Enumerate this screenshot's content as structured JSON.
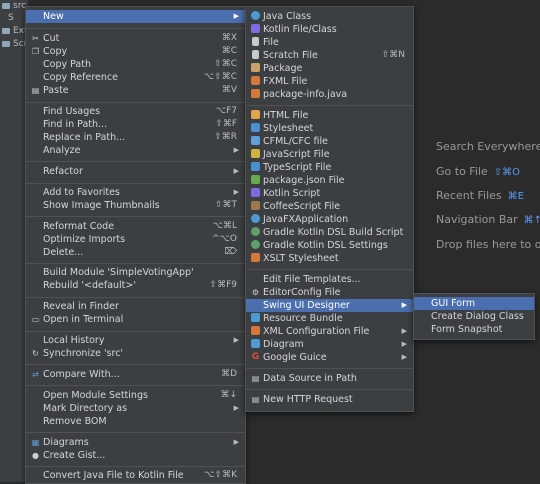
{
  "tree": [
    {
      "label": "src"
    },
    {
      "label": "S"
    },
    {
      "label": "Exte"
    },
    {
      "label": "Scra"
    }
  ],
  "hints": [
    {
      "label": "Search Everywhere",
      "shortcut": ""
    },
    {
      "label": "Go to File",
      "shortcut": "⇧⌘O"
    },
    {
      "label": "Recent Files",
      "shortcut": "⌘E"
    },
    {
      "label": "Navigation Bar",
      "shortcut": "⌘↑"
    },
    {
      "label": "Drop files here to op",
      "shortcut": ""
    }
  ],
  "context_menu": [
    {
      "label": "New",
      "shortcut": "",
      "submenu": true,
      "icon": ""
    },
    {
      "label": "Cut",
      "shortcut": "⌘X",
      "icon": "cut-icon"
    },
    {
      "label": "Copy",
      "shortcut": "⌘C",
      "icon": "copy-icon"
    },
    {
      "label": "Copy Path",
      "shortcut": "⇧⌘C",
      "icon": ""
    },
    {
      "label": "Copy Reference",
      "shortcut": "⌥⇧⌘C",
      "icon": ""
    },
    {
      "label": "Paste",
      "shortcut": "⌘V",
      "icon": "paste-icon"
    },
    {
      "label": "Find Usages",
      "shortcut": "⌥F7",
      "icon": ""
    },
    {
      "label": "Find in Path...",
      "shortcut": "⇧⌘F",
      "icon": ""
    },
    {
      "label": "Replace in Path...",
      "shortcut": "⇧⌘R",
      "icon": ""
    },
    {
      "label": "Analyze",
      "shortcut": "",
      "submenu": true,
      "icon": ""
    },
    {
      "label": "Refactor",
      "shortcut": "",
      "submenu": true,
      "icon": ""
    },
    {
      "label": "Add to Favorites",
      "shortcut": "",
      "submenu": true,
      "icon": ""
    },
    {
      "label": "Show Image Thumbnails",
      "shortcut": "⇧⌘T",
      "icon": ""
    },
    {
      "label": "Reformat Code",
      "shortcut": "⌥⌘L",
      "icon": ""
    },
    {
      "label": "Optimize Imports",
      "shortcut": "^⌥O",
      "icon": ""
    },
    {
      "label": "Delete...",
      "shortcut": "⌦",
      "icon": ""
    },
    {
      "label": "Build Module 'SimpleVotingApp'",
      "shortcut": "",
      "icon": ""
    },
    {
      "label": "Rebuild '<default>'",
      "shortcut": "⇧⌘F9",
      "icon": ""
    },
    {
      "label": "Reveal in Finder",
      "shortcut": "",
      "icon": ""
    },
    {
      "label": "Open in Terminal",
      "shortcut": "",
      "icon": "terminal-icon"
    },
    {
      "label": "Local History",
      "shortcut": "",
      "submenu": true,
      "icon": ""
    },
    {
      "label": "Synchronize 'src'",
      "shortcut": "",
      "icon": "sync-icon"
    },
    {
      "label": "Compare With...",
      "shortcut": "⌘D",
      "icon": "compare-icon"
    },
    {
      "label": "Open Module Settings",
      "shortcut": "⌘↓",
      "icon": ""
    },
    {
      "label": "Mark Directory as",
      "shortcut": "",
      "submenu": true,
      "icon": ""
    },
    {
      "label": "Remove BOM",
      "shortcut": "",
      "icon": ""
    },
    {
      "label": "Diagrams",
      "shortcut": "",
      "submenu": true,
      "icon": "diagram-icon"
    },
    {
      "label": "Create Gist...",
      "shortcut": "",
      "icon": "github-icon"
    },
    {
      "label": "Convert Java File to Kotlin File",
      "shortcut": "⌥⇧⌘K",
      "icon": ""
    }
  ],
  "new_menu": [
    {
      "label": "Java Class",
      "icon": "java-class-icon",
      "color": "#4e9bd3"
    },
    {
      "label": "Kotlin File/Class",
      "icon": "kotlin-icon",
      "color": "#7f6ae2"
    },
    {
      "label": "File",
      "icon": "file-icon",
      "color": "#c9c9c9"
    },
    {
      "label": "Scratch File",
      "shortcut": "⇧⌘N",
      "icon": "scratch-icon",
      "color": "#c9c9c9"
    },
    {
      "label": "Package",
      "icon": "package-icon",
      "color": "#c9a46a"
    },
    {
      "label": "FXML File",
      "icon": "fxml-icon",
      "color": "#d5793a"
    },
    {
      "label": "package-info.java",
      "icon": "java-file-icon",
      "color": "#d5793a"
    },
    {
      "label": "HTML File",
      "icon": "html-icon",
      "color": "#e3a34f"
    },
    {
      "label": "Stylesheet",
      "icon": "css-icon",
      "color": "#4a8fd1"
    },
    {
      "label": "CFML/CFC file",
      "icon": "cfml-icon",
      "color": "#5da1d6"
    },
    {
      "label": "JavaScript File",
      "icon": "javascript-icon",
      "color": "#d2b140"
    },
    {
      "label": "TypeScript File",
      "icon": "typescript-icon",
      "color": "#4a8fd1"
    },
    {
      "label": "package.json File",
      "icon": "npm-icon",
      "color": "#6aa84f"
    },
    {
      "label": "Kotlin Script",
      "icon": "kotlin-script-icon",
      "color": "#7f6ae2"
    },
    {
      "label": "CoffeeScript File",
      "icon": "coffeescript-icon",
      "color": "#a0774a"
    },
    {
      "label": "JavaFXApplication",
      "icon": "javafx-icon",
      "color": "#4e9bd3"
    },
    {
      "label": "Gradle Kotlin DSL Build Script",
      "icon": "gradle-icon",
      "color": "#5fa068"
    },
    {
      "label": "Gradle Kotlin DSL Settings",
      "icon": "gradle-icon",
      "color": "#5fa068"
    },
    {
      "label": "XSLT Stylesheet",
      "icon": "xslt-icon",
      "color": "#d5793a"
    },
    {
      "label": "Edit File Templates...",
      "icon": ""
    },
    {
      "label": "EditorConfig File",
      "icon": "editorconfig-icon",
      "color": "#c9c9c9"
    },
    {
      "label": "Swing UI Designer",
      "icon": "",
      "submenu": true
    },
    {
      "label": "Resource Bundle",
      "icon": "resource-bundle-icon",
      "color": "#4e9bd3"
    },
    {
      "label": "XML Configuration File",
      "icon": "xml-icon",
      "color": "#d5793a",
      "submenu": true
    },
    {
      "label": "Diagram",
      "icon": "diagram-icon",
      "color": "#4e9bd3",
      "submenu": true
    },
    {
      "label": "Google Guice",
      "icon": "google-icon",
      "color": "#dd4b3e",
      "submenu": true
    },
    {
      "label": "Data Source in Path",
      "icon": "data-source-icon",
      "color": "#c9c9c9"
    },
    {
      "label": "New HTTP Request",
      "icon": "http-request-icon",
      "color": "#c9c9c9"
    }
  ],
  "swing_menu": [
    {
      "label": "GUI Form"
    },
    {
      "label": "Create Dialog Class"
    },
    {
      "label": "Form Snapshot"
    }
  ]
}
